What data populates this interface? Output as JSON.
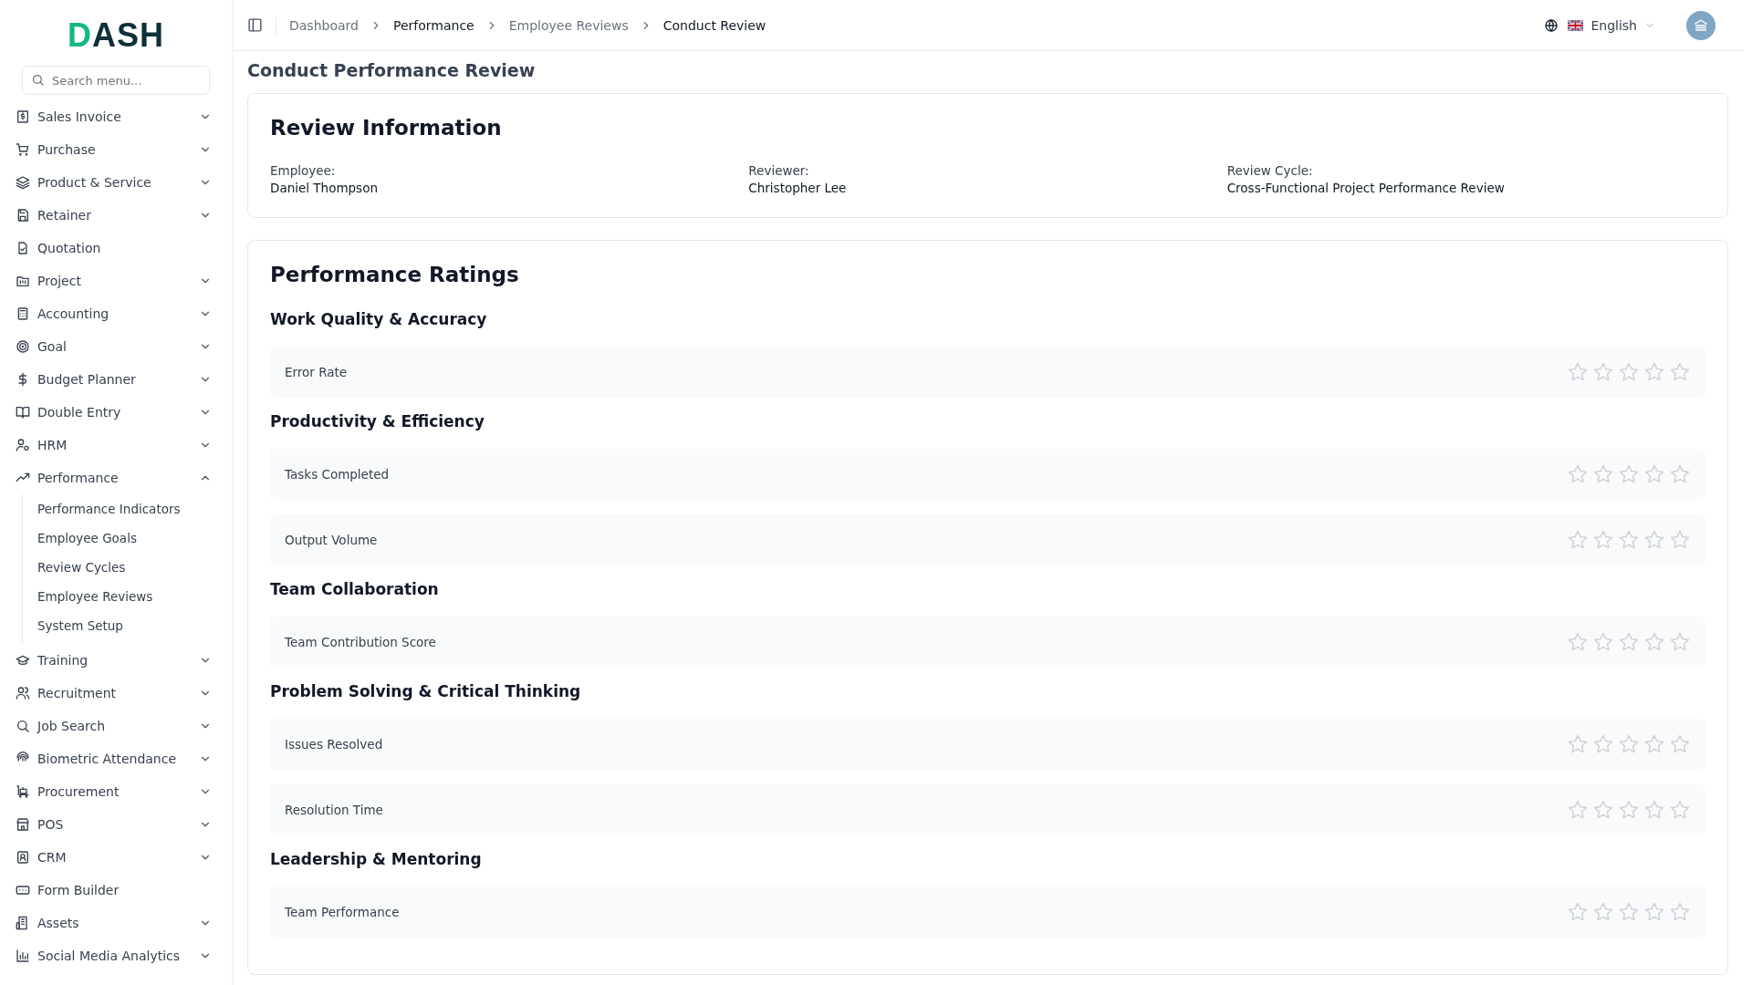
{
  "logo": "DASH",
  "search": {
    "placeholder": "Search menu..."
  },
  "sidebar": {
    "items": [
      {
        "label": "Sales Invoice",
        "expandable": true,
        "expanded": false
      },
      {
        "label": "Purchase",
        "expandable": true,
        "expanded": false
      },
      {
        "label": "Product & Service",
        "expandable": true,
        "expanded": false
      },
      {
        "label": "Retainer",
        "expandable": true,
        "expanded": false
      },
      {
        "label": "Quotation",
        "expandable": false
      },
      {
        "label": "Project",
        "expandable": true,
        "expanded": false
      },
      {
        "label": "Accounting",
        "expandable": true,
        "expanded": false
      },
      {
        "label": "Goal",
        "expandable": true,
        "expanded": false
      },
      {
        "label": "Budget Planner",
        "expandable": true,
        "expanded": false
      },
      {
        "label": "Double Entry",
        "expandable": true,
        "expanded": false
      },
      {
        "label": "HRM",
        "expandable": true,
        "expanded": false
      },
      {
        "label": "Performance",
        "expandable": true,
        "expanded": true,
        "children": [
          {
            "label": "Performance Indicators"
          },
          {
            "label": "Employee Goals"
          },
          {
            "label": "Review Cycles"
          },
          {
            "label": "Employee Reviews"
          },
          {
            "label": "System Setup"
          }
        ]
      },
      {
        "label": "Training",
        "expandable": true,
        "expanded": false
      },
      {
        "label": "Recruitment",
        "expandable": true,
        "expanded": false
      },
      {
        "label": "Job Search",
        "expandable": true,
        "expanded": false
      },
      {
        "label": "Biometric Attendance",
        "expandable": true,
        "expanded": false
      },
      {
        "label": "Procurement",
        "expandable": true,
        "expanded": false
      },
      {
        "label": "POS",
        "expandable": true,
        "expanded": false
      },
      {
        "label": "CRM",
        "expandable": true,
        "expanded": false
      },
      {
        "label": "Form Builder",
        "expandable": false
      },
      {
        "label": "Assets",
        "expandable": true,
        "expanded": false
      },
      {
        "label": "Social Media Analytics",
        "expandable": true,
        "expanded": false
      }
    ]
  },
  "breadcrumb": [
    {
      "label": "Dashboard",
      "kind": "link"
    },
    {
      "label": "Performance",
      "kind": "text"
    },
    {
      "label": "Employee Reviews",
      "kind": "link"
    },
    {
      "label": "Conduct Review",
      "kind": "text"
    }
  ],
  "language": {
    "label": "English"
  },
  "page_title": "Conduct Performance Review",
  "review_info": {
    "title": "Review Information",
    "fields": [
      {
        "label": "Employee:",
        "value": "Daniel Thompson"
      },
      {
        "label": "Reviewer:",
        "value": "Christopher Lee"
      },
      {
        "label": "Review Cycle:",
        "value": "Cross-Functional Project Performance Review"
      }
    ]
  },
  "ratings": {
    "title": "Performance Ratings",
    "groups": [
      {
        "title": "Work Quality & Accuracy",
        "criteria": [
          {
            "label": "Error Rate",
            "stars": 0
          }
        ]
      },
      {
        "title": "Productivity & Efficiency",
        "criteria": [
          {
            "label": "Tasks Completed",
            "stars": 0
          },
          {
            "label": "Output Volume",
            "stars": 0
          }
        ]
      },
      {
        "title": "Team Collaboration",
        "criteria": [
          {
            "label": "Team Contribution Score",
            "stars": 0
          }
        ]
      },
      {
        "title": "Problem Solving & Critical Thinking",
        "criteria": [
          {
            "label": "Issues Resolved",
            "stars": 0
          },
          {
            "label": "Resolution Time",
            "stars": 0
          }
        ]
      },
      {
        "title": "Leadership & Mentoring",
        "criteria": [
          {
            "label": "Team Performance",
            "stars": 0
          }
        ]
      }
    ]
  }
}
